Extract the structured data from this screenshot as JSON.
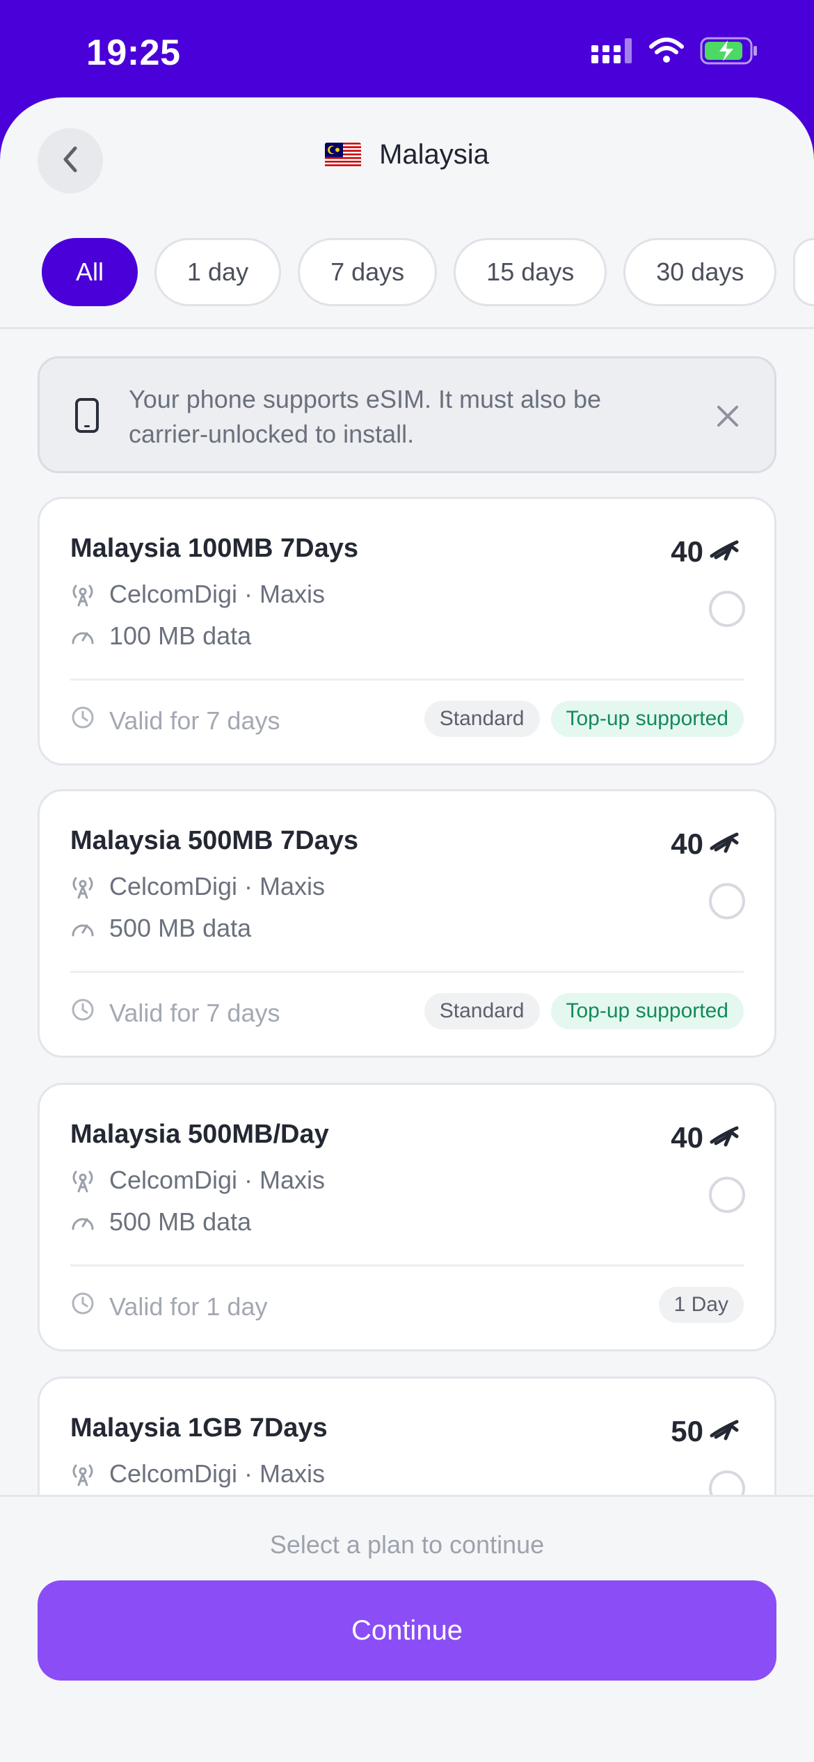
{
  "status_bar": {
    "time": "19:25"
  },
  "header": {
    "title": "Malaysia"
  },
  "filters": [
    "All",
    "1 day",
    "7 days",
    "15 days",
    "30 days"
  ],
  "notice": {
    "text": "Your phone supports eSIM. It must also be carrier-unlocked to install."
  },
  "plans": [
    {
      "name": "Malaysia 100MB 7Days",
      "price": "40",
      "operators": "CelcomDigi · Maxis",
      "data": "100 MB data",
      "validity": "Valid for 7 days",
      "tags": [
        "Standard",
        "Top-up supported"
      ]
    },
    {
      "name": "Malaysia 500MB 7Days",
      "price": "40",
      "operators": "CelcomDigi · Maxis",
      "data": "500 MB data",
      "validity": "Valid for 7 days",
      "tags": [
        "Standard",
        "Top-up supported"
      ]
    },
    {
      "name": "Malaysia 500MB/Day",
      "price": "40",
      "operators": "CelcomDigi · Maxis",
      "data": "500 MB data",
      "validity": "Valid for 1 day",
      "tags": [
        "1 Day"
      ]
    },
    {
      "name": "Malaysia 1GB 7Days",
      "price": "50",
      "operators": "CelcomDigi · Maxis"
    }
  ],
  "footer": {
    "hint": "Select a plan to continue",
    "continue_label": "Continue"
  },
  "colors": {
    "brand": "#4a00d8",
    "button": "#8b4df5",
    "tag_green_bg": "#e4f8ef",
    "tag_green_text": "#138a5a"
  },
  "icons": [
    "back-chevron-icon",
    "malaysia-flag-icon",
    "phone-icon",
    "close-icon",
    "antenna-icon",
    "gauge-icon",
    "clock-icon",
    "currency-icon",
    "signal-icon",
    "wifi-icon",
    "battery-icon"
  ]
}
